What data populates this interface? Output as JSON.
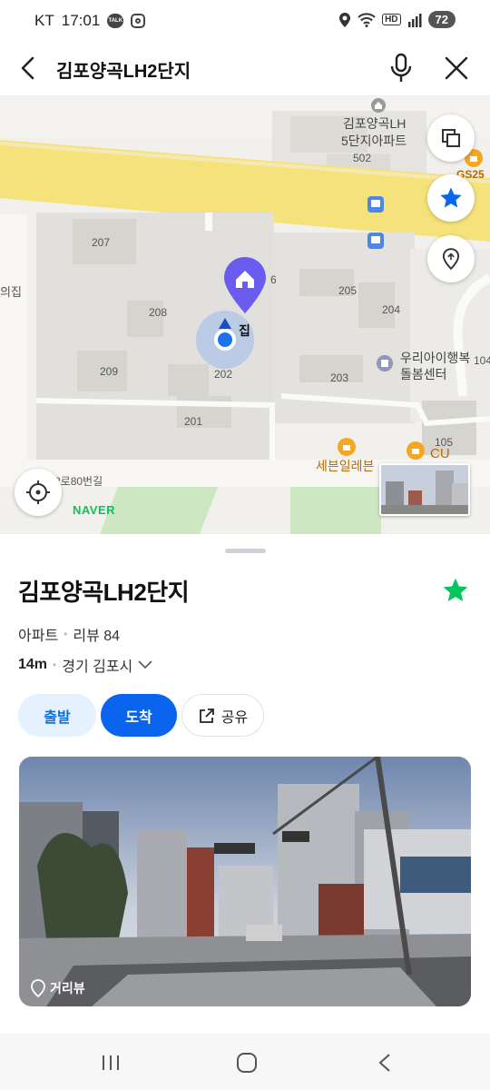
{
  "status_bar": {
    "carrier": "KT",
    "time": "17:01",
    "talk_badge": "TALK",
    "hd_badge": "HD",
    "battery": "72"
  },
  "search": {
    "query": "김포양곡LH2단지",
    "back_icon": "back-arrow-icon",
    "mic_icon": "mic-icon",
    "close_icon": "close-icon"
  },
  "map": {
    "labels": {
      "apt_name_line1": "김포양곡LH",
      "apt_name_line2": "5단지아파트",
      "b502": "502",
      "gs25": "GS25",
      "b207": "207",
      "b206_partial": "6",
      "b205": "205",
      "b204": "204",
      "b208": "208",
      "b209": "209",
      "b202": "202",
      "b203": "203",
      "b201": "201",
      "home_label": "집",
      "left_partial": "의집",
      "daycare_line1": "우리아이행복",
      "daycare_line2": "돌봄센터",
      "b104_partial": "104",
      "seven_eleven": "세븐일레븐",
      "cu": "CU",
      "b105": "105",
      "road": "2로80번길"
    },
    "logo": "NAVER",
    "accent": "#1a73e8",
    "marker_color": "#6b5cf0"
  },
  "place": {
    "title": "김포양곡LH2단지",
    "category": "아파트",
    "reviews": "리뷰 84",
    "distance": "14m",
    "address": "경기 김포시",
    "favorite_color": "#03c75a"
  },
  "actions": {
    "depart": "출발",
    "arrive": "도착",
    "share": "공유"
  },
  "photo": {
    "label": "거리뷰"
  }
}
